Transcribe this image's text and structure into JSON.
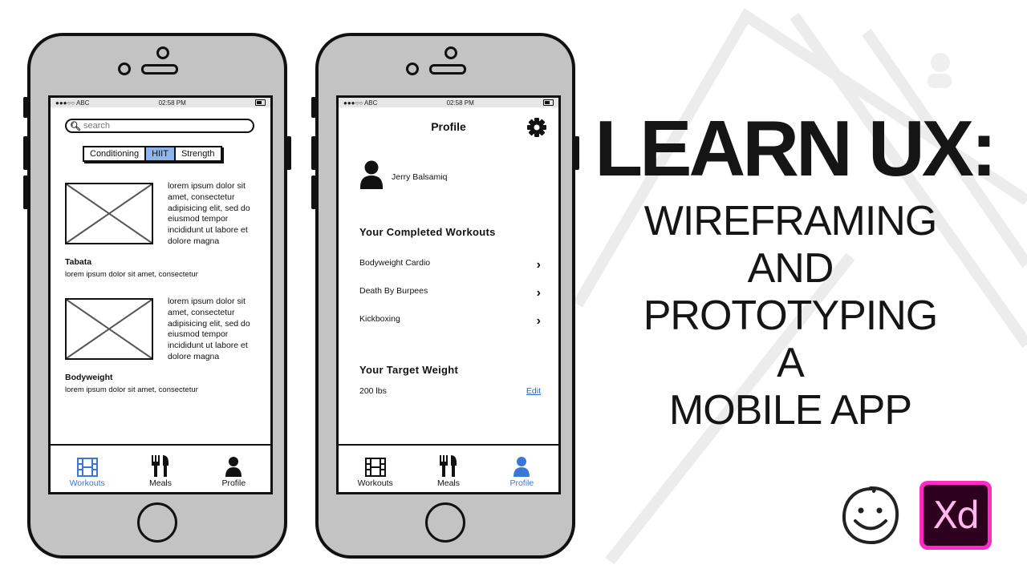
{
  "phone_left": {
    "status": {
      "carrier": "●●●○○ ABC",
      "time": "02:58 PM"
    },
    "search": {
      "placeholder": "search",
      "icon": "search-icon"
    },
    "segments": [
      {
        "label": "Conditioning",
        "active": false
      },
      {
        "label": "HIIT",
        "active": true
      },
      {
        "label": "Strength",
        "active": false
      }
    ],
    "cards": [
      {
        "description": "lorem ipsum dolor sit amet, consectetur adipisicing elit, sed do eiusmod tempor incididunt ut labore et dolore magna",
        "title": "Tabata",
        "subtitle": "lorem ipsum dolor sit amet, consectetur"
      },
      {
        "description": "lorem ipsum dolor sit amet, consectetur adipisicing elit, sed do eiusmod tempor incididunt ut labore et dolore magna",
        "title": "Bodyweight",
        "subtitle": "lorem ipsum dolor sit amet, consectetur"
      }
    ],
    "tabs": [
      {
        "label": "Workouts",
        "icon": "film-icon",
        "active": true
      },
      {
        "label": "Meals",
        "icon": "fork-knife-icon",
        "active": false
      },
      {
        "label": "Profile",
        "icon": "user-icon",
        "active": false
      }
    ]
  },
  "phone_right": {
    "status": {
      "carrier": "●●●○○ ABC",
      "time": "02:58 PM"
    },
    "title": "Profile",
    "settings_icon": "gear-icon",
    "user_name": "Jerry Balsamiq",
    "completed_heading": "Your Completed Workouts",
    "workouts": [
      "Bodyweight Cardio",
      "Death By Burpees",
      "Kickboxing"
    ],
    "weight_heading": "Your Target Weight",
    "weight_value": "200 lbs",
    "edit_label": "Edit",
    "tabs": [
      {
        "label": "Workouts",
        "icon": "film-icon",
        "active": false
      },
      {
        "label": "Meals",
        "icon": "fork-knife-icon",
        "active": false
      },
      {
        "label": "Profile",
        "icon": "user-icon",
        "active": true
      }
    ]
  },
  "headline": {
    "main": "LEARN UX:",
    "lines": [
      "WIREFRAMING",
      "AND",
      "PROTOTYPING",
      "A",
      "MOBILE APP"
    ]
  },
  "logos": {
    "balsamiq": "balsamiq-smiley-logo",
    "xd": "Xd"
  },
  "colors": {
    "accent_blue": "#3a78d8",
    "segment_active": "#8fb5ea",
    "phone_body": "#c3c3c3",
    "xd_pink": "#ff2bc2",
    "xd_dark": "#2e001f"
  }
}
